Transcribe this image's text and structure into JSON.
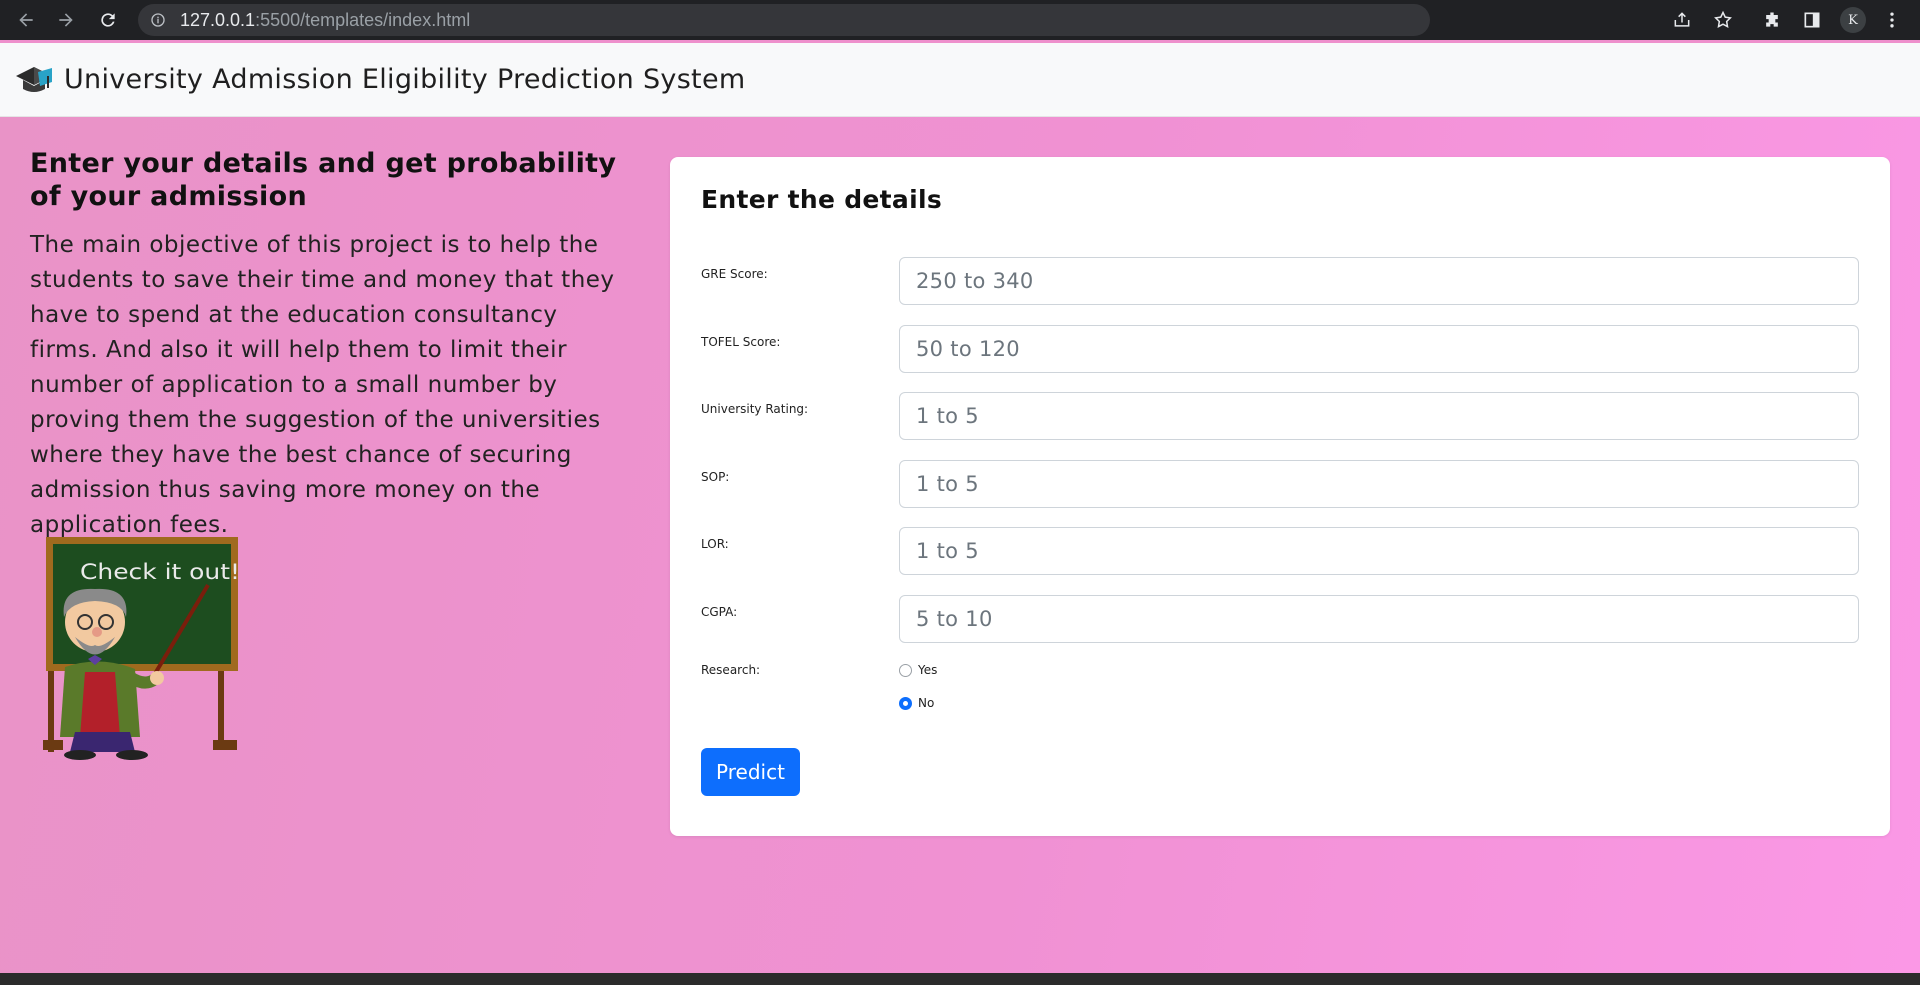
{
  "browser": {
    "url_host": "127.0.0.1",
    "url_rest": ":5500/templates/index.html",
    "profile_initial": "K"
  },
  "navbar": {
    "title": "University Admission Eligibility Prediction System"
  },
  "intro": {
    "heading": "Enter your details and get probability of your admission",
    "body": "The main objective of this project is to help the students to save their time and money that they have to spend at the education consultancy firms. And also it will help them to limit their number of application to a small number by proving them the suggestion of the universities where they have the best chance of securing admission thus saving more money on the application fees.",
    "image_text": "Check it out!"
  },
  "form": {
    "heading": "Enter the details",
    "fields": [
      {
        "label": "GRE Score:",
        "placeholder": "250 to 340",
        "value": ""
      },
      {
        "label": "TOFEL Score:",
        "placeholder": "50 to 120",
        "value": ""
      },
      {
        "label": "University Rating:",
        "placeholder": "1 to 5",
        "value": ""
      },
      {
        "label": "SOP:",
        "placeholder": "1 to 5",
        "value": ""
      },
      {
        "label": "LOR:",
        "placeholder": "1 to 5",
        "value": ""
      },
      {
        "label": "CGPA:",
        "placeholder": "5 to 10",
        "value": ""
      }
    ],
    "research": {
      "label": "Research:",
      "options": [
        {
          "label": "Yes",
          "checked": false
        },
        {
          "label": "No",
          "checked": true
        }
      ]
    },
    "submit_label": "Predict"
  },
  "colors": {
    "accent": "#0d6efd",
    "page_background": "#ee90cc",
    "navbar_background": "#f8f9fa"
  }
}
